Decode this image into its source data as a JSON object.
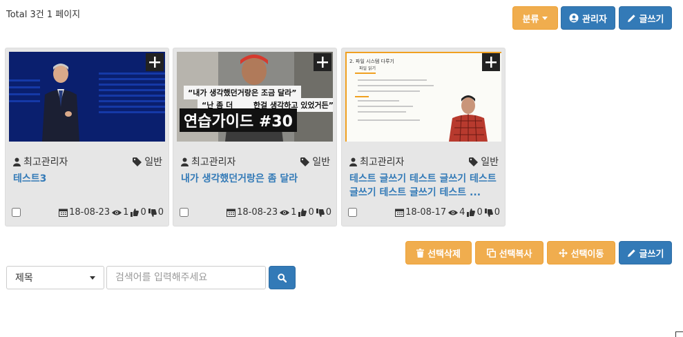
{
  "header": {
    "total_text": "Total 3건 1 페이지",
    "category_label": "분류",
    "admin_label": "관리자",
    "write_label": "글쓰기"
  },
  "posts": [
    {
      "author": "최고관리자",
      "category": "일반",
      "title": "테스트3",
      "date": "18-08-23",
      "views": "1",
      "likes": "0",
      "dislikes": "0",
      "thumbnail": {
        "type": "photo",
        "caption_lines": []
      }
    },
    {
      "author": "최고관리자",
      "category": "일반",
      "title": "내가 생각했던거랑은 좀 달라",
      "date": "18-08-23",
      "views": "1",
      "likes": "0",
      "dislikes": "0",
      "thumbnail": {
        "type": "video",
        "caption_lines": [
          "“내가 생각했던거랑은 조금 달라”",
          "“난 좀 더 ____ 한걸 생각하고 있었거든”",
          "연습가이드 #30"
        ]
      }
    },
    {
      "author": "최고관리자",
      "category": "일반",
      "title": "테스트 글쓰기 테스트 글쓰기 테스트 글쓰기 테스트 글쓰기 테스트 ...",
      "date": "18-08-17",
      "views": "4",
      "likes": "0",
      "dislikes": "0",
      "thumbnail": {
        "type": "slide",
        "caption_lines": [
          "2. 파일 시스템 다루기",
          "파일 읽기"
        ]
      }
    }
  ],
  "actions": {
    "delete_label": "선택삭제",
    "copy_label": "선택복사",
    "move_label": "선택이동",
    "write_label": "글쓰기"
  },
  "search": {
    "field_selected": "제목",
    "placeholder": "검색어를 입력해주세요"
  },
  "colors": {
    "warning": "#f0ad4e",
    "primary": "#337ab7",
    "card_bg": "#e6e6e6"
  }
}
